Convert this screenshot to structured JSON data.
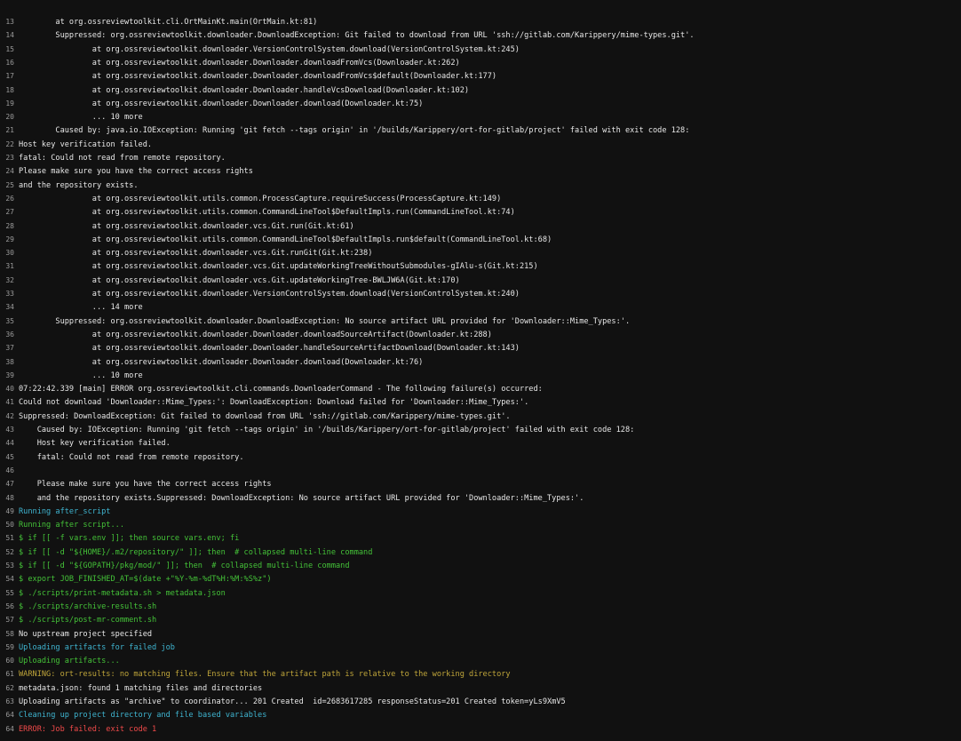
{
  "colors": {
    "background": "#111111",
    "text": "#e8e8e8",
    "section": "#3fb5d1",
    "command": "#44c238",
    "warning": "#bfa53a",
    "error": "#f04a4a"
  },
  "lines": [
    {
      "n": "13",
      "color": "white",
      "text": "        at org.ossreviewtoolkit.cli.OrtMainKt.main(OrtMain.kt:81)"
    },
    {
      "n": "14",
      "color": "white",
      "text": "        Suppressed: org.ossreviewtoolkit.downloader.DownloadException: Git failed to download from URL 'ssh://gitlab.com/Karippery/mime-types.git'."
    },
    {
      "n": "15",
      "color": "white",
      "text": "                at org.ossreviewtoolkit.downloader.VersionControlSystem.download(VersionControlSystem.kt:245)"
    },
    {
      "n": "16",
      "color": "white",
      "text": "                at org.ossreviewtoolkit.downloader.Downloader.downloadFromVcs(Downloader.kt:262)"
    },
    {
      "n": "17",
      "color": "white",
      "text": "                at org.ossreviewtoolkit.downloader.Downloader.downloadFromVcs$default(Downloader.kt:177)"
    },
    {
      "n": "18",
      "color": "white",
      "text": "                at org.ossreviewtoolkit.downloader.Downloader.handleVcsDownload(Downloader.kt:102)"
    },
    {
      "n": "19",
      "color": "white",
      "text": "                at org.ossreviewtoolkit.downloader.Downloader.download(Downloader.kt:75)"
    },
    {
      "n": "20",
      "color": "white",
      "text": "                ... 10 more"
    },
    {
      "n": "21",
      "color": "white",
      "text": "        Caused by: java.io.IOException: Running 'git fetch --tags origin' in '/builds/Karippery/ort-for-gitlab/project' failed with exit code 128:"
    },
    {
      "n": "22",
      "color": "white",
      "text": "Host key verification failed."
    },
    {
      "n": "23",
      "color": "white",
      "text": "fatal: Could not read from remote repository."
    },
    {
      "n": "24",
      "color": "white",
      "text": "Please make sure you have the correct access rights"
    },
    {
      "n": "25",
      "color": "white",
      "text": "and the repository exists."
    },
    {
      "n": "26",
      "color": "white",
      "text": "                at org.ossreviewtoolkit.utils.common.ProcessCapture.requireSuccess(ProcessCapture.kt:149)"
    },
    {
      "n": "27",
      "color": "white",
      "text": "                at org.ossreviewtoolkit.utils.common.CommandLineTool$DefaultImpls.run(CommandLineTool.kt:74)"
    },
    {
      "n": "28",
      "color": "white",
      "text": "                at org.ossreviewtoolkit.downloader.vcs.Git.run(Git.kt:61)"
    },
    {
      "n": "29",
      "color": "white",
      "text": "                at org.ossreviewtoolkit.utils.common.CommandLineTool$DefaultImpls.run$default(CommandLineTool.kt:68)"
    },
    {
      "n": "30",
      "color": "white",
      "text": "                at org.ossreviewtoolkit.downloader.vcs.Git.runGit(Git.kt:238)"
    },
    {
      "n": "31",
      "color": "white",
      "text": "                at org.ossreviewtoolkit.downloader.vcs.Git.updateWorkingTreeWithoutSubmodules-gIAlu-s(Git.kt:215)"
    },
    {
      "n": "32",
      "color": "white",
      "text": "                at org.ossreviewtoolkit.downloader.vcs.Git.updateWorkingTree-BWLJW6A(Git.kt:170)"
    },
    {
      "n": "33",
      "color": "white",
      "text": "                at org.ossreviewtoolkit.downloader.VersionControlSystem.download(VersionControlSystem.kt:240)"
    },
    {
      "n": "34",
      "color": "white",
      "text": "                ... 14 more"
    },
    {
      "n": "35",
      "color": "white",
      "text": "        Suppressed: org.ossreviewtoolkit.downloader.DownloadException: No source artifact URL provided for 'Downloader::Mime_Types:'."
    },
    {
      "n": "36",
      "color": "white",
      "text": "                at org.ossreviewtoolkit.downloader.Downloader.downloadSourceArtifact(Downloader.kt:288)"
    },
    {
      "n": "37",
      "color": "white",
      "text": "                at org.ossreviewtoolkit.downloader.Downloader.handleSourceArtifactDownload(Downloader.kt:143)"
    },
    {
      "n": "38",
      "color": "white",
      "text": "                at org.ossreviewtoolkit.downloader.Downloader.download(Downloader.kt:76)"
    },
    {
      "n": "39",
      "color": "white",
      "text": "                ... 10 more"
    },
    {
      "n": "40",
      "color": "white",
      "text": "07:22:42.339 [main] ERROR org.ossreviewtoolkit.cli.commands.DownloaderCommand - The following failure(s) occurred:"
    },
    {
      "n": "41",
      "color": "white",
      "text": "Could not download 'Downloader::Mime_Types:': DownloadException: Download failed for 'Downloader::Mime_Types:'."
    },
    {
      "n": "42",
      "color": "white",
      "text": "Suppressed: DownloadException: Git failed to download from URL 'ssh://gitlab.com/Karippery/mime-types.git'."
    },
    {
      "n": "43",
      "color": "white",
      "text": "    Caused by: IOException: Running 'git fetch --tags origin' in '/builds/Karippery/ort-for-gitlab/project' failed with exit code 128:"
    },
    {
      "n": "44",
      "color": "white",
      "text": "    Host key verification failed."
    },
    {
      "n": "45",
      "color": "white",
      "text": "    fatal: Could not read from remote repository."
    },
    {
      "n": "46",
      "color": "white",
      "text": ""
    },
    {
      "n": "47",
      "color": "white",
      "text": "    Please make sure you have the correct access rights"
    },
    {
      "n": "48",
      "color": "white",
      "text": "    and the repository exists.Suppressed: DownloadException: No source artifact URL provided for 'Downloader::Mime_Types:'."
    },
    {
      "n": "49",
      "color": "cyan",
      "text": "Running after_script"
    },
    {
      "n": "50",
      "color": "green",
      "text": "Running after script..."
    },
    {
      "n": "51",
      "color": "green",
      "text": "$ if [[ -f vars.env ]]; then source vars.env; fi"
    },
    {
      "n": "52",
      "color": "green",
      "text": "$ if [[ -d \"${HOME}/.m2/repository/\" ]]; then  # collapsed multi-line command"
    },
    {
      "n": "53",
      "color": "green",
      "text": "$ if [[ -d \"${GOPATH}/pkg/mod/\" ]]; then  # collapsed multi-line command"
    },
    {
      "n": "54",
      "color": "green",
      "text": "$ export JOB_FINISHED_AT=$(date +\"%Y-%m-%dT%H:%M:%S%z\")"
    },
    {
      "n": "55",
      "color": "green",
      "text": "$ ./scripts/print-metadata.sh > metadata.json"
    },
    {
      "n": "56",
      "color": "green",
      "text": "$ ./scripts/archive-results.sh"
    },
    {
      "n": "57",
      "color": "green",
      "text": "$ ./scripts/post-mr-comment.sh"
    },
    {
      "n": "58",
      "color": "white",
      "text": "No upstream project specified"
    },
    {
      "n": "59",
      "color": "cyan",
      "text": "Uploading artifacts for failed job"
    },
    {
      "n": "60",
      "color": "green",
      "text": "Uploading artifacts..."
    },
    {
      "n": "61",
      "color": "yellow",
      "text": "WARNING: ort-results: no matching files. Ensure that the artifact path is relative to the working directory"
    },
    {
      "n": "62",
      "color": "white",
      "text": "metadata.json: found 1 matching files and directories"
    },
    {
      "n": "63",
      "color": "white",
      "text": "Uploading artifacts as \"archive\" to coordinator... 201 Created  id=2683617285 responseStatus=201 Created token=yLs9XmV5"
    },
    {
      "n": "64",
      "color": "cyan",
      "text": "Cleaning up project directory and file based variables"
    },
    {
      "n": "64",
      "color": "red",
      "text": "ERROR: Job failed: exit code 1"
    }
  ]
}
